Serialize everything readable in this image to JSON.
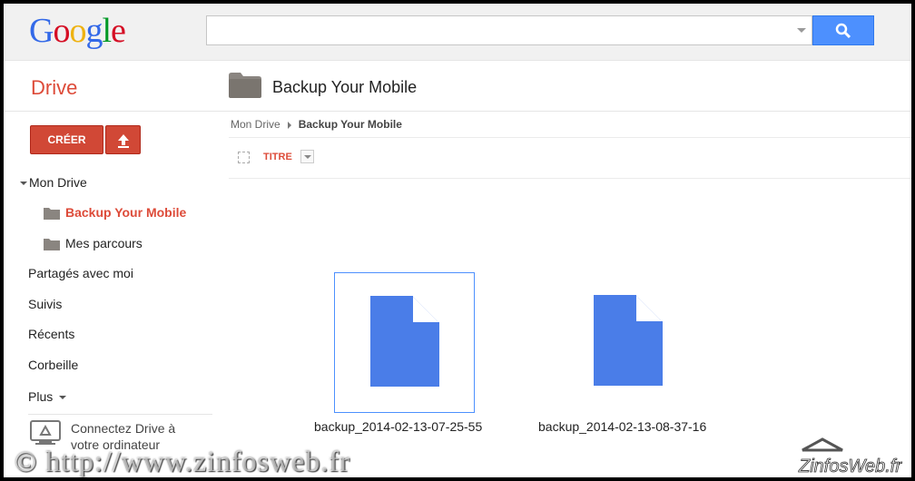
{
  "topbar": {
    "logo_letters": [
      "G",
      "o",
      "o",
      "g",
      "l",
      "e"
    ],
    "logo_colors": [
      "#3369e8",
      "#d50f25",
      "#eeb211",
      "#3369e8",
      "#009925",
      "#d50f25"
    ],
    "search_placeholder": ""
  },
  "header": {
    "app_name": "Drive",
    "page_title": "Backup Your Mobile"
  },
  "sidebar": {
    "create_label": "CRÉER",
    "items": [
      {
        "label": "Mon Drive"
      },
      {
        "label": "Backup Your Mobile"
      },
      {
        "label": "Mes parcours"
      },
      {
        "label": "Partagés avec moi"
      },
      {
        "label": "Suivis"
      },
      {
        "label": "Récents"
      },
      {
        "label": "Corbeille"
      },
      {
        "label": "Plus"
      }
    ],
    "connect_text": "Connectez Drive à votre ordinateur"
  },
  "breadcrumb": {
    "root": "Mon Drive",
    "current": "Backup Your Mobile"
  },
  "list_header": {
    "title_col": "TITRE"
  },
  "files": [
    {
      "name": "backup_2014-02-13-07-25-55",
      "selected": true
    },
    {
      "name": "backup_2014-02-13-08-37-16",
      "selected": false
    }
  ],
  "watermark": {
    "text": "© http://www.zinfosweb.fr",
    "brand": "ZinfosWeb.fr"
  },
  "colors": {
    "accent_red": "#dd4b39",
    "button_red": "#d14836",
    "search_blue": "#4d90fe",
    "file_blue": "#4a7de8",
    "folder_gray": "#8a8580"
  }
}
